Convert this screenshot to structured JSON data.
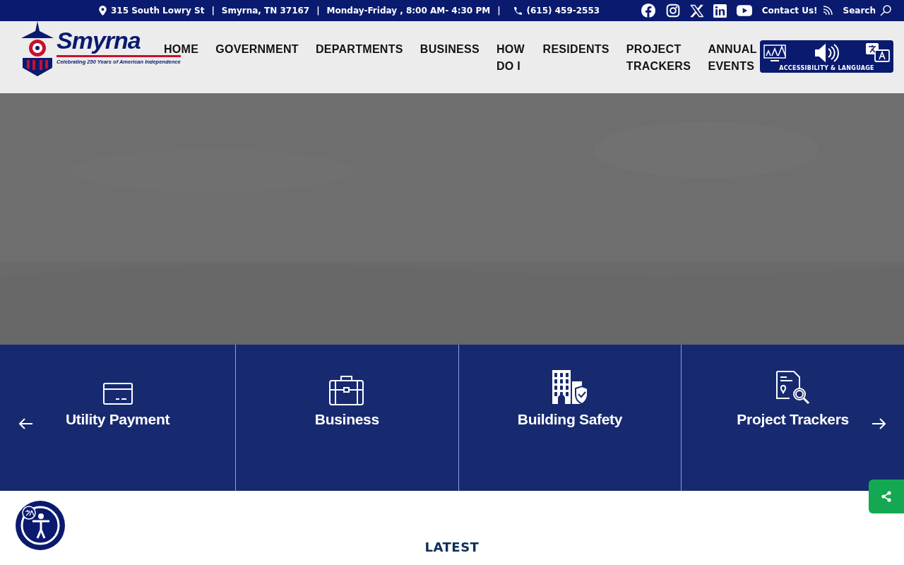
{
  "top_bar": {
    "address": "315 South Lowry St",
    "separator_1": "|",
    "city": "Smyrna, TN 37167",
    "separator_2": "|",
    "hours": "Monday-Friday , 8:00 AM- 4:30 PM",
    "separator_3": "|",
    "phone": "(615) 459-2553",
    "social": [
      {
        "kind": "facebook"
      },
      {
        "kind": "instagram"
      },
      {
        "kind": "x"
      },
      {
        "kind": "linkedin"
      },
      {
        "kind": "youtube"
      }
    ],
    "contact": "Contact Us!",
    "search": "Search"
  },
  "logo": {
    "name": "Smyrna",
    "tagline": "Celebrating **250** Years of American Independence"
  },
  "nav": [
    {
      "label": "HOME"
    },
    {
      "label": "GOVERNMENT"
    },
    {
      "label": "DEPARTMENTS"
    },
    {
      "label": "BUSINESS"
    },
    {
      "label": "HOW DO I"
    },
    {
      "label": "RESIDENTS"
    },
    {
      "label": "PROJECT TRACKERS"
    },
    {
      "label": "ANNUAL EVENTS"
    }
  ],
  "accessibility_button": {
    "label": "ACCESSIBILITY & LANGUAGE"
  },
  "tiles": [
    {
      "kind": "card",
      "label": "Utility Payment"
    },
    {
      "kind": "briefcase",
      "label": "Business"
    },
    {
      "kind": "building",
      "label": "Building Safety"
    },
    {
      "kind": "document",
      "label": "Project Trackers"
    }
  ],
  "section": {
    "eyebrow": "LATEST"
  }
}
